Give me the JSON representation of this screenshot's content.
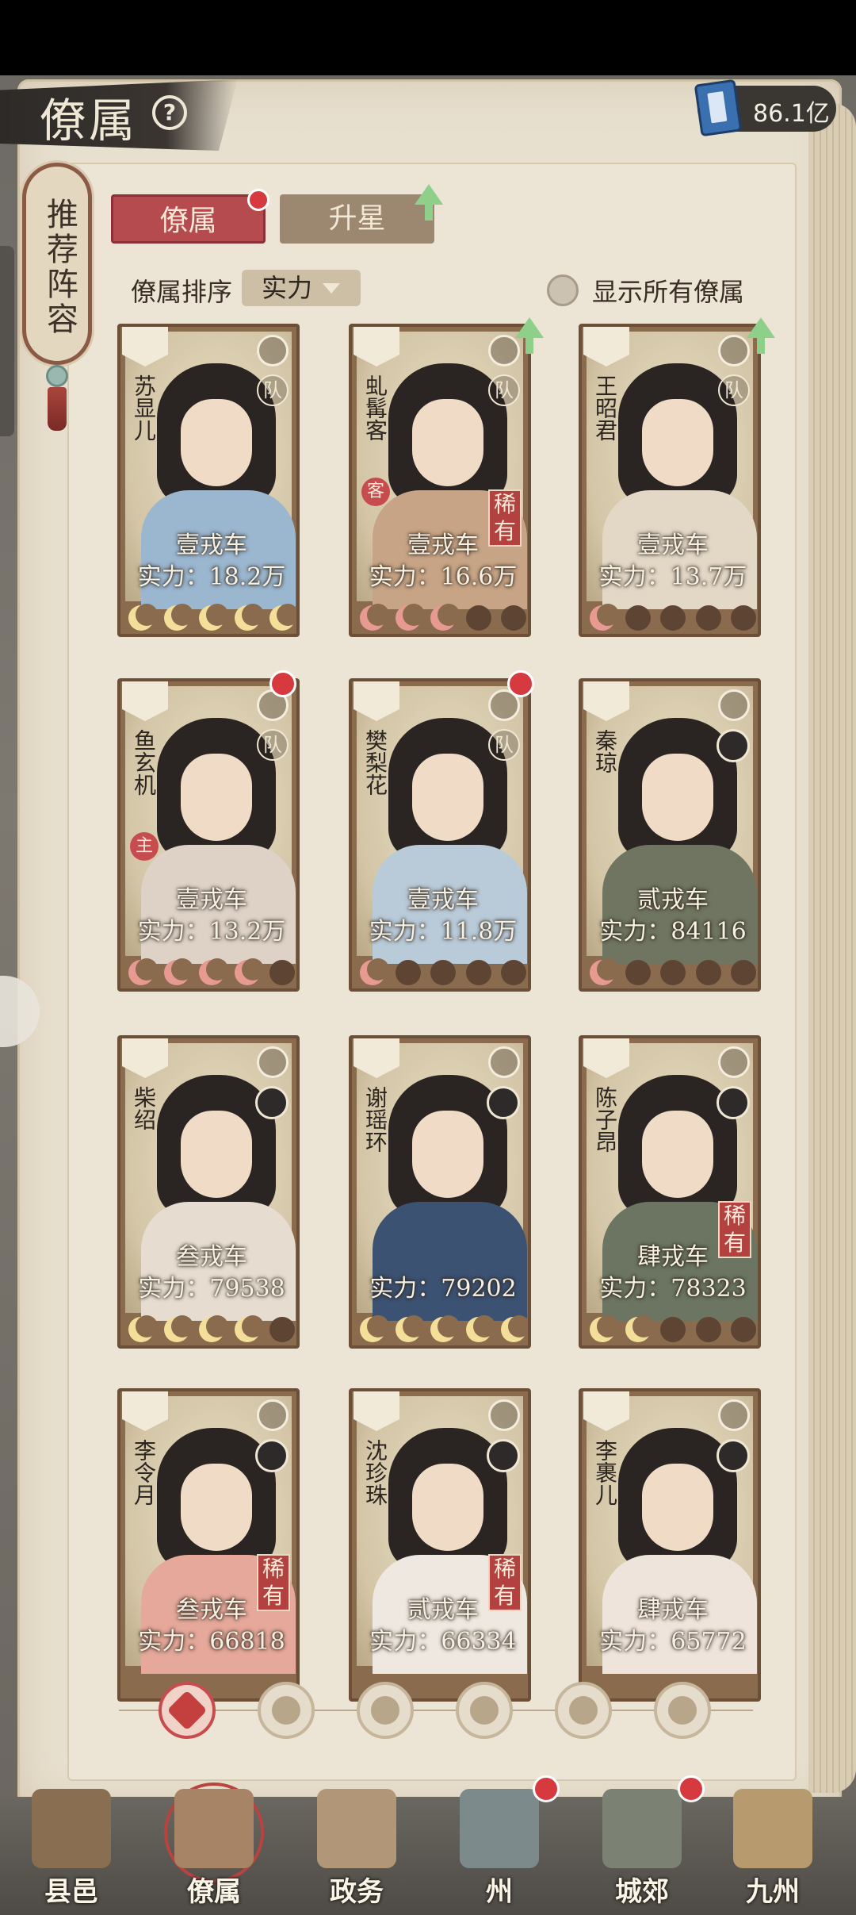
{
  "header": {
    "title": "僚属",
    "help_icon": "question-icon",
    "currency_value": "86.1亿",
    "currency_icon": "book-icon"
  },
  "side_tag": {
    "text": "推荐阵容"
  },
  "tabs": [
    {
      "label": "僚属",
      "active": true
    },
    {
      "label": "升星",
      "active": false
    }
  ],
  "sort": {
    "label": "僚属排序",
    "value": "实力"
  },
  "toggle": {
    "label": "显示所有僚属"
  },
  "cards": [
    {
      "name": "苏显儿",
      "car": "壹戎车",
      "power": "实力：18.2万",
      "moons": [
        "gold",
        "gold",
        "gold",
        "gold",
        "gold"
      ],
      "team": "队",
      "badge": "fan",
      "icon": "sword"
    },
    {
      "name": "虬髯客",
      "car": "壹戎车",
      "power": "实力：16.6万",
      "moons": [
        "pink",
        "pink",
        "pink",
        "empty",
        "empty"
      ],
      "team": "队",
      "side": "客",
      "rare": "稀有",
      "badge": "cat",
      "icon": "book"
    },
    {
      "name": "王昭君",
      "car": "壹戎车",
      "power": "实力：13.7万",
      "moons": [
        "pink",
        "empty",
        "empty",
        "empty",
        "empty"
      ],
      "team": "队",
      "badge": "cat",
      "icon": "taiji"
    },
    {
      "name": "鱼玄机",
      "car": "壹戎车",
      "power": "实力：13.2万",
      "moons": [
        "pink",
        "pink",
        "pink",
        "pink",
        "empty"
      ],
      "team": "队",
      "side": "主",
      "badge": "fan",
      "icon": "gear"
    },
    {
      "name": "樊梨花",
      "car": "壹戎车",
      "power": "实力：11.8万",
      "moons": [
        "pink",
        "empty",
        "empty",
        "empty",
        "empty"
      ],
      "team": "队",
      "badge": "fan",
      "icon": "book"
    },
    {
      "name": "秦琼",
      "car": "贰戎车",
      "power": "实力：84116",
      "moons": [
        "pink",
        "empty",
        "empty",
        "empty",
        "empty"
      ],
      "badge": "helmet",
      "icon": "sword"
    },
    {
      "name": "柴绍",
      "car": "叁戎车",
      "power": "实力：79538",
      "moons": [
        "gold",
        "gold",
        "gold",
        "gold",
        "empty"
      ],
      "badge": "horse",
      "icon": "sword"
    },
    {
      "name": "谢瑶环",
      "car": "",
      "power": "实力：79202",
      "moons": [
        "gold",
        "gold",
        "gold",
        "gold",
        "gold"
      ],
      "badge": "helmet",
      "icon": "sword"
    },
    {
      "name": "陈子昂",
      "car": "肆戎车",
      "power": "实力：78323",
      "moons": [
        "gold",
        "gold",
        "empty",
        "empty",
        "empty"
      ],
      "rare": "稀有",
      "badge": "fan",
      "icon": "sword"
    },
    {
      "name": "李令月",
      "car": "叁戎车",
      "power": "实力：66818",
      "moons": [],
      "rare": "稀有",
      "badge": "horse",
      "icon": "taiji"
    },
    {
      "name": "沈珍珠",
      "car": "贰戎车",
      "power": "实力：66334",
      "moons": [],
      "rare": "稀有",
      "badge": "cat",
      "icon": "taiji"
    },
    {
      "name": "李裹儿",
      "car": "肆戎车",
      "power": "实力：65772",
      "moons": [],
      "badge": "horse",
      "icon": "taiji"
    }
  ],
  "pager": [
    "all-icon",
    "helmet-icon",
    "cat-icon",
    "fan-icon",
    "horse-icon",
    "mask-icon"
  ],
  "nav": [
    {
      "label": "县邑",
      "icon": "town-icon"
    },
    {
      "label": "僚属",
      "icon": "officials-icon",
      "selected": true
    },
    {
      "label": "政务",
      "icon": "scroll-icon"
    },
    {
      "label": "州",
      "icon": "mountain-icon"
    },
    {
      "label": "城郊",
      "icon": "suburb-icon"
    },
    {
      "label": "九州",
      "icon": "map-icon"
    }
  ],
  "colors": {
    "accent": "#b54a4f",
    "paper": "#ece5d5",
    "frame": "#8b6b4e"
  }
}
